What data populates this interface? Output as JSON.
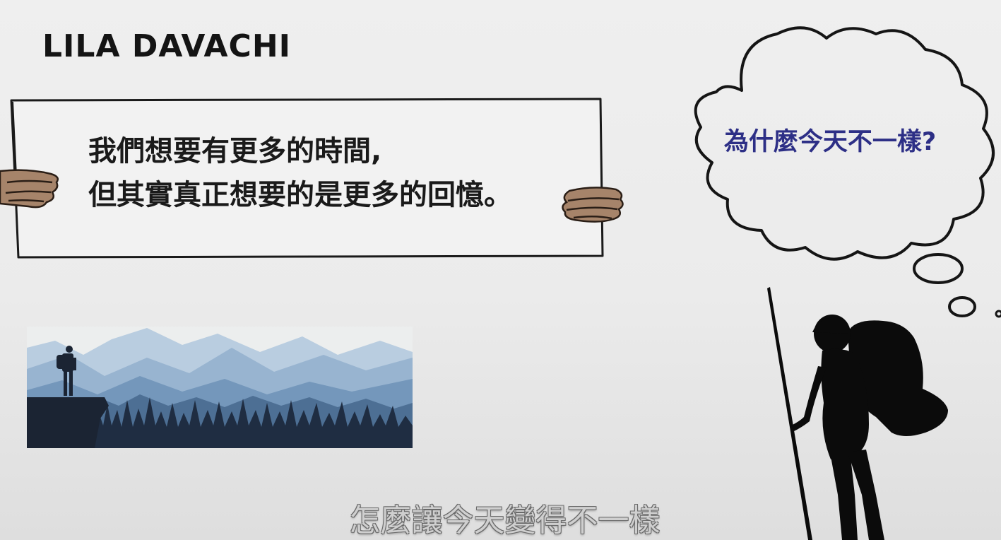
{
  "speaker_name": "LILA DAVACHI",
  "sign": {
    "line1": "我們想要有更多的時間,",
    "line2": "但其實真正想要的是更多的回憶。"
  },
  "thought_bubble": {
    "text": "為什麼今天不一樣?"
  },
  "subtitle": "怎麼讓今天變得不一樣",
  "colors": {
    "background": "#ececec",
    "thought_text": "#2d2f86",
    "ink": "#1a1a1a",
    "hand_skin": "#a6846a",
    "mountain_light": "#9cb7d2",
    "mountain_mid": "#6f92b6",
    "forest_dark": "#1f2d42"
  }
}
